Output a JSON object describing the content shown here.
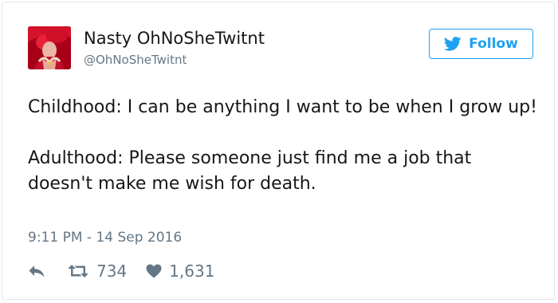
{
  "user": {
    "display_name": "Nasty OhNoSheTwitnt",
    "handle": "@OhNoSheTwitnt",
    "avatar_icon": "profile-photo"
  },
  "follow_button": {
    "label": "Follow",
    "icon": "twitter-bird-icon",
    "color": "#1da1f2"
  },
  "tweet": {
    "paragraph_1": "Childhood: I can be anything I want to be when I grow up!",
    "paragraph_2": "Adulthood: Please someone just find me a job that doesn't make me wish for death.",
    "timestamp": "9:11 PM - 14 Sep 2016"
  },
  "actions": {
    "reply_icon": "reply-icon",
    "retweet_icon": "retweet-icon",
    "retweet_count": "734",
    "like_icon": "heart-icon",
    "like_count": "1,631"
  },
  "colors": {
    "text": "#14171a",
    "secondary": "#657786",
    "border": "#e1e8ed"
  }
}
